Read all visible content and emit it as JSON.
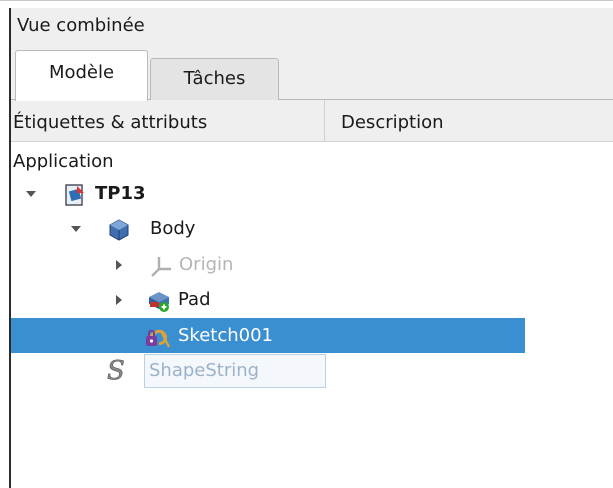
{
  "dock": {
    "title": "Vue combinée"
  },
  "tabs": [
    {
      "label": "Modèle",
      "active": true
    },
    {
      "label": "Tâches",
      "active": false
    }
  ],
  "tree": {
    "columns": [
      "Étiquettes & attributs",
      "Description"
    ],
    "root_label": "Application",
    "items": [
      {
        "label": "TP13",
        "icon": "document-icon",
        "expanded": true,
        "bold": true
      },
      {
        "label": "Body",
        "icon": "body-icon",
        "expanded": true
      },
      {
        "label": "Origin",
        "icon": "origin-axes-icon",
        "expanded": false,
        "hidden": true
      },
      {
        "label": "Pad",
        "icon": "pad-icon",
        "expanded": false
      },
      {
        "label": "Sketch001",
        "icon": "sketch-icon",
        "selected": true
      },
      {
        "label": "ShapeString",
        "icon": "shapestring-icon",
        "editing": true
      }
    ]
  },
  "colors": {
    "selection": "#3a8fd0",
    "hidden_text": "#b5b5b5"
  }
}
